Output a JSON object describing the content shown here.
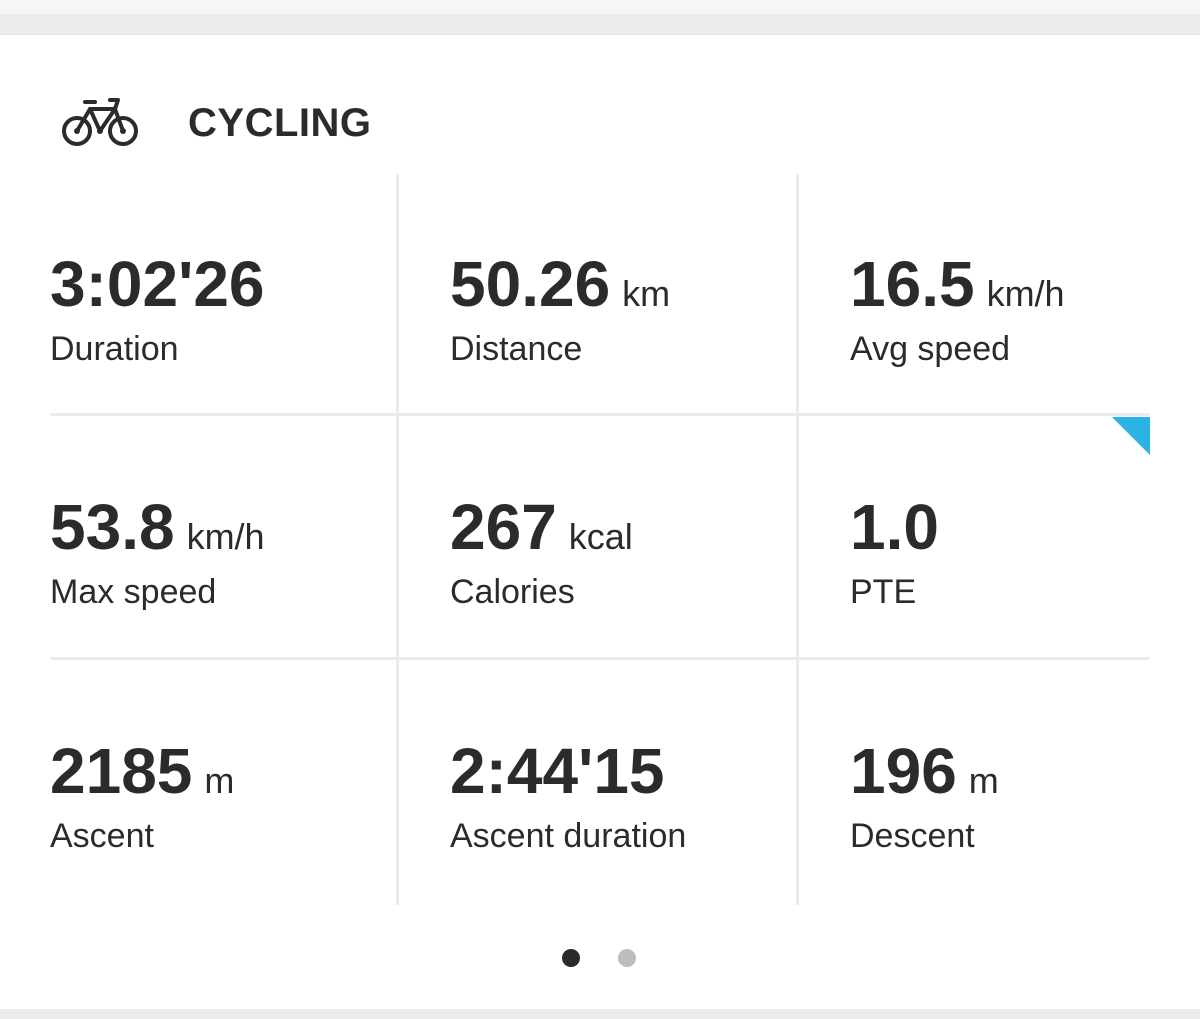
{
  "activity": {
    "icon": "bicycle-icon",
    "title": "CYCLING"
  },
  "stats": [
    {
      "value": "3:02'26",
      "unit": "",
      "label": "Duration"
    },
    {
      "value": "50.26",
      "unit": "km",
      "label": "Distance"
    },
    {
      "value": "16.5",
      "unit": "km/h",
      "label": "Avg speed"
    },
    {
      "value": "53.8",
      "unit": "km/h",
      "label": "Max speed"
    },
    {
      "value": "267",
      "unit": "kcal",
      "label": "Calories"
    },
    {
      "value": "1.0",
      "unit": "",
      "label": "PTE"
    },
    {
      "value": "2185",
      "unit": "m",
      "label": "Ascent"
    },
    {
      "value": "2:44'15",
      "unit": "",
      "label": "Ascent duration"
    },
    {
      "value": "196",
      "unit": "m",
      "label": "Descent"
    }
  ],
  "pager": {
    "current_page": 1,
    "total_pages": 2
  },
  "colors": {
    "text": "#2b2b2b",
    "divider": "#ececec",
    "accent": "#2bb3e6",
    "dot_active": "#2b2b2b",
    "dot_inactive": "#bdbdbd"
  }
}
